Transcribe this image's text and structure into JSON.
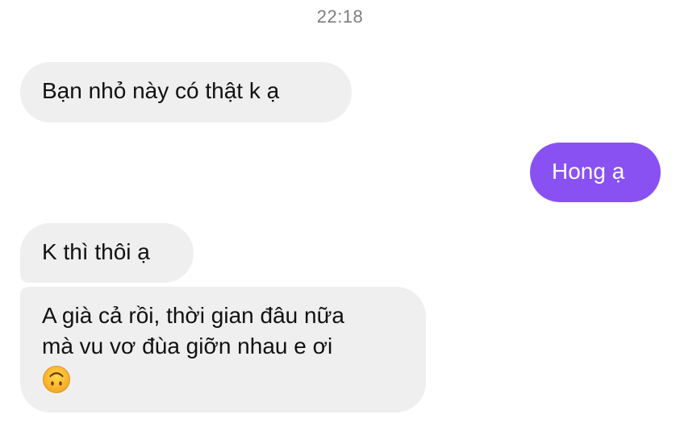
{
  "conversation": {
    "timestamp": "22:18",
    "messages": [
      {
        "direction": "incoming",
        "text": "Bạn nhỏ này có thật k ạ"
      },
      {
        "direction": "outgoing",
        "text": "Hong ạ"
      },
      {
        "direction": "incoming",
        "text": "K thì thôi ạ"
      },
      {
        "direction": "incoming",
        "lines": [
          "A già cả rồi, thời gian đâu nữa",
          "mà vu vơ đùa giỡn nhau e ơi"
        ],
        "emoji": "upside-down-face-icon"
      }
    ]
  },
  "colors": {
    "incoming_bubble": "#efefef",
    "outgoing_bubble": "#8a51f2",
    "timestamp_text": "#7d7d7d"
  }
}
